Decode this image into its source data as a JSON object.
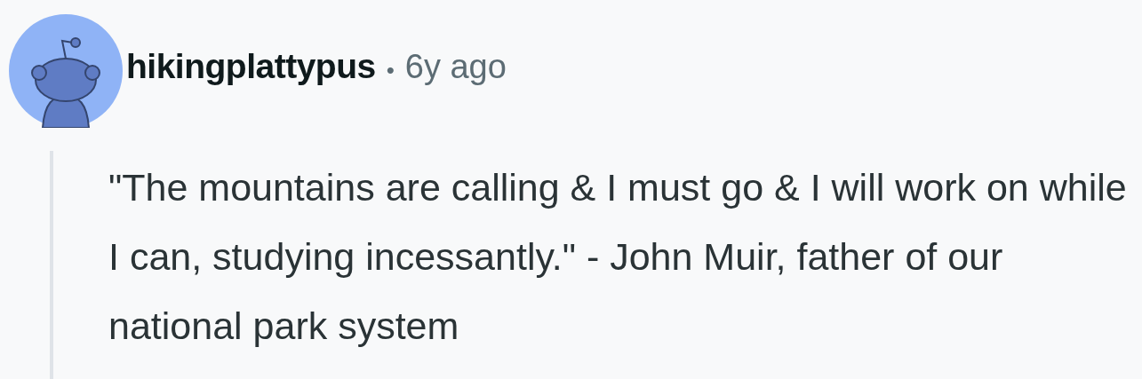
{
  "comment": {
    "author": "hikingplattypus",
    "separator": "•",
    "age": "6y ago",
    "body": "\"The mountains are calling & I must go & I will work on while I can, studying incessantly.\" - John Muir, father of our national park system"
  }
}
